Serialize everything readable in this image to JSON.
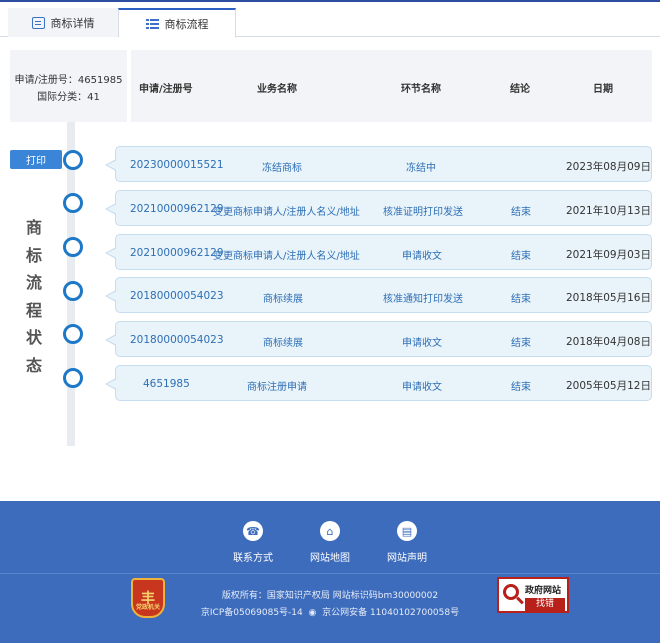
{
  "tabs": [
    {
      "label": "商标详情",
      "icon": "document-icon"
    },
    {
      "label": "商标流程",
      "icon": "list-icon"
    }
  ],
  "info": {
    "reg_no": "申请/注册号：4651985",
    "class": "国际分类：41"
  },
  "table_headers": {
    "reg_no": "申请/注册号",
    "business": "业务名称",
    "step": "环节名称",
    "result": "结论",
    "date": "日期"
  },
  "print_button": "打印",
  "side_title": [
    "商",
    "标",
    "流",
    "程",
    "状",
    "态"
  ],
  "flows": [
    {
      "reg_no": "20230000015521",
      "business": "冻结商标",
      "step": "冻结中",
      "result": "",
      "date": "2023年08月09日"
    },
    {
      "reg_no": "20210000962129",
      "business": "变更商标申请人/注册人名义/地址",
      "step": "核准证明打印发送",
      "result": "结束",
      "date": "2021年10月13日"
    },
    {
      "reg_no": "20210000962129",
      "business": "变更商标申请人/注册人名义/地址",
      "step": "申请收文",
      "result": "结束",
      "date": "2021年09月03日"
    },
    {
      "reg_no": "20180000054023",
      "business": "商标续展",
      "step": "核准通知打印发送",
      "result": "结束",
      "date": "2018年05月16日"
    },
    {
      "reg_no": "20180000054023",
      "business": "商标续展",
      "step": "申请收文",
      "result": "结束",
      "date": "2018年04月08日"
    },
    {
      "reg_no": "4651985",
      "business": "商标注册申请",
      "step": "申请收文",
      "result": "结束",
      "date": "2005年05月12日"
    }
  ],
  "footer": {
    "links": [
      {
        "label": "联系方式",
        "icon": "phone-icon"
      },
      {
        "label": "网站地图",
        "icon": "sitemap-icon"
      },
      {
        "label": "网站声明",
        "icon": "statement-icon"
      }
    ],
    "copyright": "版权所有：国家知识产权局 网站标识码bm30000002",
    "icp": "京ICP备05069085号-14",
    "police": "京公网安备 11040102700058号",
    "emblem_text": "党政机关",
    "gov_badge_title": "政府网站",
    "gov_badge_action": "找错",
    "color_primary": "#3d6cbd",
    "color_accent": "#1e78c8"
  }
}
